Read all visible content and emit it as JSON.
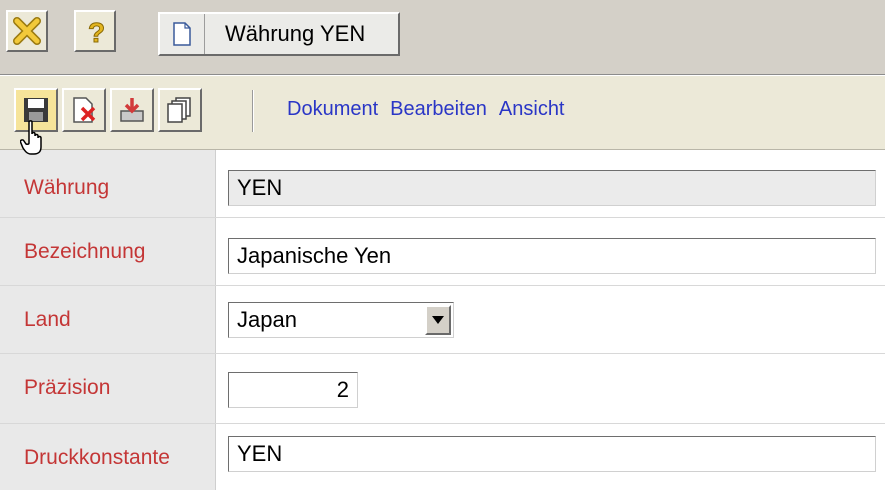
{
  "window": {
    "tab_title": "Währung YEN"
  },
  "titlebar_icons": [
    "close-icon",
    "help-icon",
    "document-icon"
  ],
  "toolbar": {
    "tools": [
      "save-icon",
      "delete-icon",
      "export-icon",
      "copy-icon"
    ],
    "menu": [
      "Dokument",
      "Bearbeiten",
      "Ansicht"
    ]
  },
  "form": {
    "waehrung": {
      "label": "Währung",
      "value": "YEN"
    },
    "bezeichnung": {
      "label": "Bezeichnung",
      "value": "Japanische Yen"
    },
    "land": {
      "label": "Land",
      "value": "Japan"
    },
    "praezision": {
      "label": "Präzision",
      "value": "2"
    },
    "druckkonstante": {
      "label": "Druckkonstante",
      "value": "YEN"
    }
  },
  "colors": {
    "label_red": "#c43636",
    "menu_blue": "#2a36c6",
    "active_tool": "#f6e49a"
  }
}
